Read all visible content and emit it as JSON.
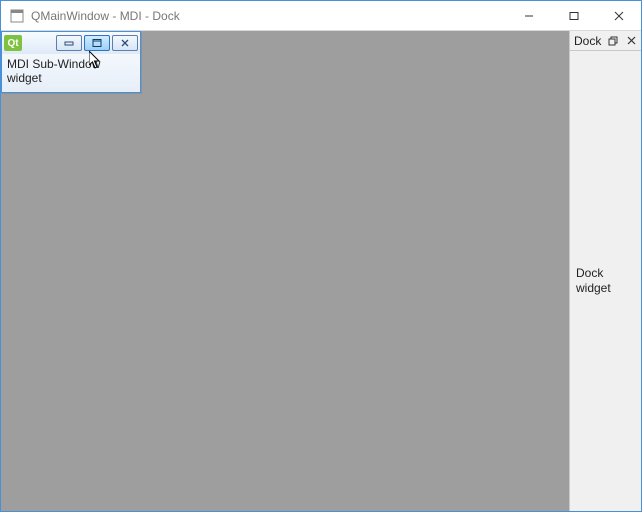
{
  "window": {
    "title": "QMainWindow - MDI - Dock"
  },
  "mdi": {
    "subwindow": {
      "icon_label": "Qt",
      "body_text": "MDI Sub-Window widget"
    }
  },
  "dock": {
    "title": "Dock",
    "body_text": "Dock widget"
  }
}
